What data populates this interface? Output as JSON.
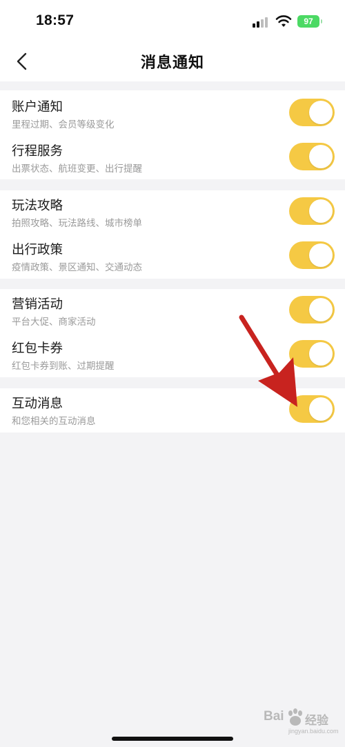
{
  "status_bar": {
    "time": "18:57",
    "battery": "97"
  },
  "nav": {
    "title": "消息通知",
    "back_icon": "chevron-left-icon"
  },
  "groups": [
    {
      "items": [
        {
          "title": "账户通知",
          "subtitle": "里程过期、会员等级变化",
          "enabled": true
        },
        {
          "title": "行程服务",
          "subtitle": "出票状态、航班变更、出行提醒",
          "enabled": true
        }
      ]
    },
    {
      "items": [
        {
          "title": "玩法攻略",
          "subtitle": "拍照攻略、玩法路线、城市榜单",
          "enabled": true
        },
        {
          "title": "出行政策",
          "subtitle": "疫情政策、景区通知、交通动态",
          "enabled": true
        }
      ]
    },
    {
      "items": [
        {
          "title": "营销活动",
          "subtitle": "平台大促、商家活动",
          "enabled": true
        },
        {
          "title": "红包卡券",
          "subtitle": "红包卡券到账、过期提醒",
          "enabled": true
        }
      ]
    },
    {
      "items": [
        {
          "title": "互动消息",
          "subtitle": "和您相关的互动消息",
          "enabled": true
        }
      ]
    }
  ],
  "watermark": {
    "brand": "Bai",
    "cn": "经验",
    "url": "jingyan.baidu.com"
  },
  "colors": {
    "toggle_on": "#f5c944",
    "background": "#f3f3f5",
    "annotation_arrow": "#c8231f"
  }
}
